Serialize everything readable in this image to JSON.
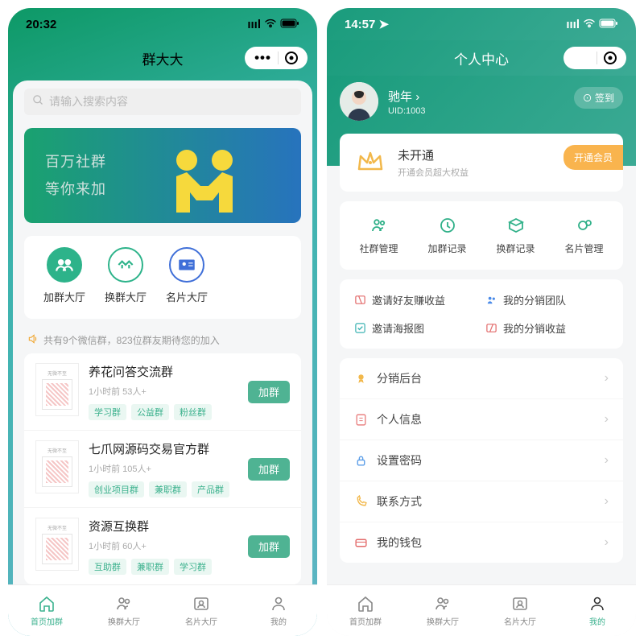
{
  "left": {
    "status_time": "20:32",
    "header_title": "群大大",
    "search_placeholder": "请输入搜索内容",
    "banner_line1": "百万社群",
    "banner_line2": "等你来加",
    "categories": [
      {
        "label": "加群大厅"
      },
      {
        "label": "换群大厅"
      },
      {
        "label": "名片大厅"
      }
    ],
    "notice_text": "共有9个微信群，823位群友期待您的加入",
    "groups": [
      {
        "title": "养花问答交流群",
        "meta": "1小时前 53人+",
        "tags": [
          "学习群",
          "公益群",
          "粉丝群"
        ],
        "btn": "加群"
      },
      {
        "title": "七爪网源码交易官方群",
        "meta": "1小时前 105人+",
        "tags": [
          "创业项目群",
          "兼职群",
          "产品群"
        ],
        "btn": "加群"
      },
      {
        "title": "资源互换群",
        "meta": "1小时前 60人+",
        "tags": [
          "互助群",
          "兼职群",
          "学习群"
        ],
        "btn": "加群"
      }
    ],
    "tabs": [
      {
        "label": "首页加群"
      },
      {
        "label": "换群大厅"
      },
      {
        "label": "名片大厅"
      },
      {
        "label": "我的"
      }
    ]
  },
  "right": {
    "status_time": "14:57",
    "header_title": "个人中心",
    "user_name": "驰年",
    "user_id": "UID:1003",
    "checkin_label": "签到",
    "vip_title": "未开通",
    "vip_sub": "开通会员超大权益",
    "vip_btn": "开通会员",
    "services": [
      {
        "label": "社群管理"
      },
      {
        "label": "加群记录"
      },
      {
        "label": "换群记录"
      },
      {
        "label": "名片管理"
      }
    ],
    "links": [
      {
        "label": "邀请好友赚收益"
      },
      {
        "label": "我的分销团队"
      },
      {
        "label": "邀请海报图"
      },
      {
        "label": "我的分销收益"
      }
    ],
    "menu": [
      {
        "label": "分销后台"
      },
      {
        "label": "个人信息"
      },
      {
        "label": "设置密码"
      },
      {
        "label": "联系方式"
      },
      {
        "label": "我的钱包"
      }
    ],
    "tabs": [
      {
        "label": "首页加群"
      },
      {
        "label": "换群大厅"
      },
      {
        "label": "名片大厅"
      },
      {
        "label": "我的"
      }
    ]
  }
}
